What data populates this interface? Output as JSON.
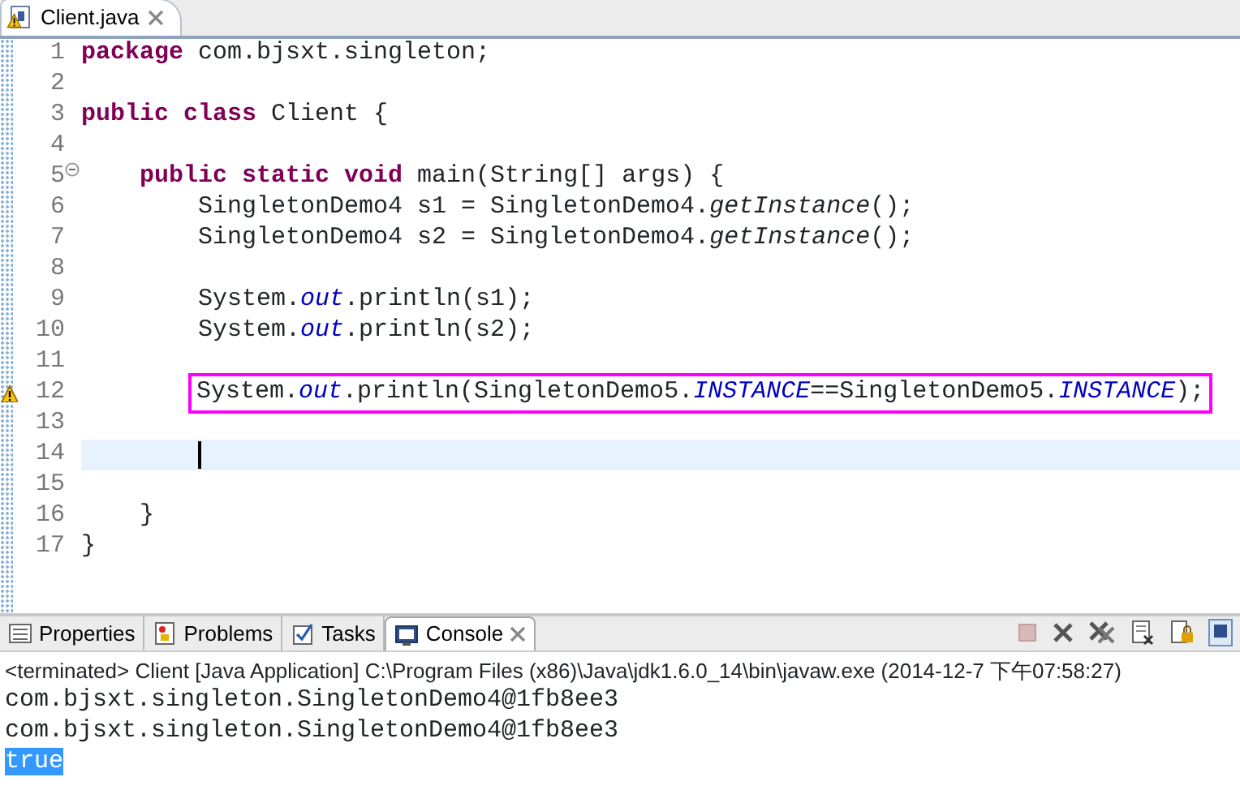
{
  "editor_tab": {
    "label": "Client.java",
    "warning": true
  },
  "code_lines": [
    {
      "number": "1",
      "fold": false,
      "warning": false,
      "current": false,
      "boxed": false,
      "tokens": [
        {
          "kind": "keyword",
          "text": "package"
        },
        {
          "kind": "plain",
          "text": " com.bjsxt.singleton;"
        }
      ]
    },
    {
      "number": "2",
      "fold": false,
      "warning": false,
      "current": false,
      "boxed": false
    },
    {
      "number": "3",
      "fold": false,
      "warning": false,
      "current": false,
      "boxed": false,
      "tokens": [
        {
          "kind": "keyword",
          "text": "public class"
        },
        {
          "kind": "plain",
          "text": " Client {"
        }
      ]
    },
    {
      "number": "4",
      "fold": false,
      "warning": false,
      "current": false,
      "boxed": false
    },
    {
      "number": "5",
      "fold": true,
      "warning": false,
      "current": false,
      "boxed": false,
      "tokens": [
        {
          "kind": "keyword",
          "text": "    public static void"
        },
        {
          "kind": "plain",
          "text": " main(String[] args) {"
        }
      ]
    },
    {
      "number": "6",
      "fold": false,
      "warning": false,
      "current": false,
      "boxed": false,
      "tokens": [
        {
          "kind": "plain",
          "text": "        SingletonDemo4 s1 = SingletonDemo4."
        },
        {
          "kind": "method",
          "text": "getInstance"
        },
        {
          "kind": "plain",
          "text": "();"
        }
      ]
    },
    {
      "number": "7",
      "fold": false,
      "warning": false,
      "current": false,
      "boxed": false,
      "tokens": [
        {
          "kind": "plain",
          "text": "        SingletonDemo4 s2 = SingletonDemo4."
        },
        {
          "kind": "method",
          "text": "getInstance"
        },
        {
          "kind": "plain",
          "text": "();"
        }
      ]
    },
    {
      "number": "8",
      "fold": false,
      "warning": false,
      "current": false,
      "boxed": false
    },
    {
      "number": "9",
      "fold": false,
      "warning": false,
      "current": false,
      "boxed": false,
      "tokens": [
        {
          "kind": "plain",
          "text": "        System."
        },
        {
          "kind": "field",
          "text": "out"
        },
        {
          "kind": "plain",
          "text": ".println(s1);"
        }
      ]
    },
    {
      "number": "10",
      "fold": false,
      "warning": false,
      "current": false,
      "boxed": false,
      "tokens": [
        {
          "kind": "plain",
          "text": "        System."
        },
        {
          "kind": "field",
          "text": "out"
        },
        {
          "kind": "plain",
          "text": ".println(s2);"
        }
      ]
    },
    {
      "number": "11",
      "fold": false,
      "warning": false,
      "current": false,
      "boxed": false
    },
    {
      "number": "12",
      "fold": false,
      "warning": true,
      "current": false,
      "boxed": true,
      "tokens": [
        {
          "kind": "plain",
          "text": "System."
        },
        {
          "kind": "field",
          "text": "out"
        },
        {
          "kind": "plain",
          "text": ".println(SingletonDemo5."
        },
        {
          "kind": "field",
          "text": "INSTANCE"
        },
        {
          "kind": "plain",
          "text": "==SingletonDemo5."
        },
        {
          "kind": "field",
          "text": "INSTANCE"
        },
        {
          "kind": "plain",
          "text": ");"
        }
      ]
    },
    {
      "number": "13",
      "fold": false,
      "warning": false,
      "current": false,
      "boxed": false
    },
    {
      "number": "14",
      "fold": false,
      "warning": false,
      "current": true,
      "boxed": false
    },
    {
      "number": "15",
      "fold": false,
      "warning": false,
      "current": false,
      "boxed": false
    },
    {
      "number": "16",
      "fold": false,
      "warning": false,
      "current": false,
      "boxed": false,
      "tokens": [
        {
          "kind": "plain",
          "text": "    }"
        }
      ]
    },
    {
      "number": "17",
      "fold": false,
      "warning": false,
      "current": false,
      "boxed": false,
      "tokens": [
        {
          "kind": "plain",
          "text": "}"
        }
      ]
    }
  ],
  "panel_tabs": [
    {
      "label": "Properties",
      "selected": false
    },
    {
      "label": "Problems",
      "selected": false
    },
    {
      "label": "Tasks",
      "selected": false
    },
    {
      "label": "Console",
      "selected": true
    }
  ],
  "console_status": "<terminated> Client [Java Application] C:\\Program Files (x86)\\Java\\jdk1.6.0_14\\bin\\javaw.exe (2014-12-7 下午07:58:27)",
  "console_lines": [
    {
      "text": "com.bjsxt.singleton.SingletonDemo4@1fb8ee3",
      "selected": false
    },
    {
      "text": "com.bjsxt.singleton.SingletonDemo4@1fb8ee3",
      "selected": false
    },
    {
      "text": "true",
      "selected": true
    }
  ]
}
